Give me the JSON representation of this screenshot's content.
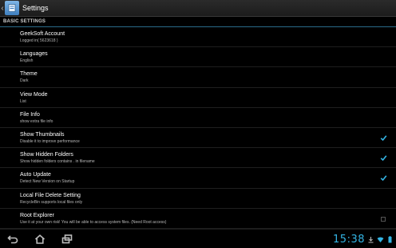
{
  "actionbar": {
    "title": "Settings",
    "up_icon": "chevron-left-icon",
    "app_icon": "file-manager-icon"
  },
  "section": {
    "header": "BASIC SETTINGS"
  },
  "settings": [
    {
      "title": "GeekSoft Account",
      "summary": "Logged in( 5623618 )",
      "checkbox": null
    },
    {
      "title": "Languages",
      "summary": "English",
      "checkbox": null
    },
    {
      "title": "Theme",
      "summary": "Dark",
      "checkbox": null
    },
    {
      "title": "View Mode",
      "summary": "List",
      "checkbox": null
    },
    {
      "title": "File Info",
      "summary": "show extra file info",
      "checkbox": null
    },
    {
      "title": "Show Thumbnails",
      "summary": "Disable it to improve performance",
      "checkbox": true
    },
    {
      "title": "Show Hidden Folders",
      "summary": "Show hidden folders contains . in filename",
      "checkbox": true
    },
    {
      "title": "Auto Update",
      "summary": "Detect New Version on Startup",
      "checkbox": true
    },
    {
      "title": "Local File Delete Setting",
      "summary": "RecycleBin supports local files only",
      "checkbox": null
    },
    {
      "title": "Root Explorer",
      "summary": "Use it at your own risk! You will be able to access system files. (Need Root access)",
      "checkbox": false
    }
  ],
  "navbar": {
    "clock": "15:38",
    "buttons": [
      "back-icon",
      "home-icon",
      "recent-apps-icon"
    ],
    "tray_icons": [
      "download-icon",
      "wifi-icon",
      "battery-icon"
    ]
  },
  "colors": {
    "accent": "#33b5e5",
    "background": "#000000",
    "divider": "#1e1e1e"
  }
}
